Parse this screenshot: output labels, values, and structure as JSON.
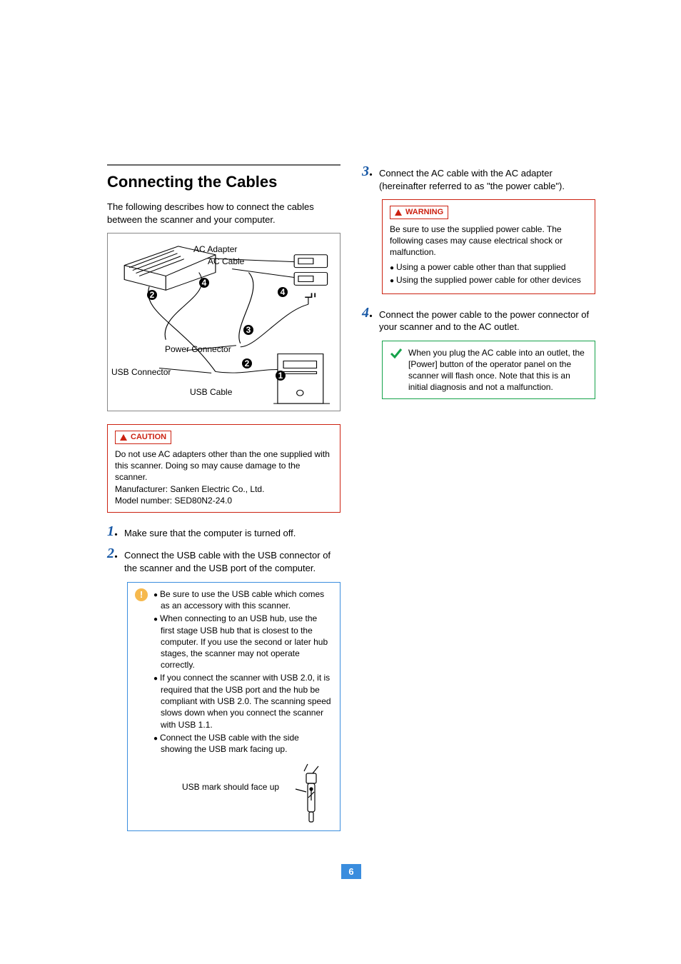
{
  "title": "Connecting the Cables",
  "intro": "The following describes how to connect the cables between the scanner and your computer.",
  "diagram": {
    "ac_adapter": "AC Adapter",
    "ac_cable": "AC Cable",
    "power_connector": "Power Connector",
    "usb_connector": "USB Connector",
    "usb_cable": "USB Cable",
    "n1": "1",
    "n2": "2",
    "n2b": "2",
    "n3": "3",
    "n4": "4",
    "n4b": "4"
  },
  "caution": {
    "label": "CAUTION",
    "text": "Do not use AC adapters other than the one supplied with this scanner. Doing so may cause damage to the scanner.\nManufacturer: Sanken Electric Co., Ltd.\nModel number: SED80N2-24.0"
  },
  "steps": {
    "s1": "Make sure that the computer is turned off.",
    "s2": "Connect the USB cable with the USB connector of the scanner and the USB port of the computer.",
    "s3": "Connect the AC cable with the AC adapter (hereinafter referred to as \"the power cable\").",
    "s4": "Connect the power cable to the power connector of your scanner and to the AC outlet."
  },
  "usb_note": {
    "b1": "Be sure to use the USB cable which comes as an accessory with this scanner.",
    "b2": "When connecting to an USB hub, use the first stage USB hub that is closest to the computer. If you use the second or later hub stages, the scanner may not operate correctly.",
    "b3": "If you connect the scanner with USB 2.0, it is required that the USB port and the hub be compliant with USB 2.0. The scanning speed slows down when you connect the scanner with USB 1.1.",
    "b4": "Connect the USB cable with the side showing the USB mark facing up.",
    "usb_mark": "USB mark should face up"
  },
  "warning": {
    "label": "WARNING",
    "text": "Be sure to use the supplied power cable. The following cases may cause electrical shock or malfunction.",
    "b1": "Using a power cable other than that supplied",
    "b2": "Using the supplied power cable for other devices"
  },
  "plug_note": "When you plug the AC cable into an outlet, the [Power] button of the operator panel on the scanner will flash once. Note that this is an initial diagnosis and not a malfunction.",
  "page_number": "6"
}
